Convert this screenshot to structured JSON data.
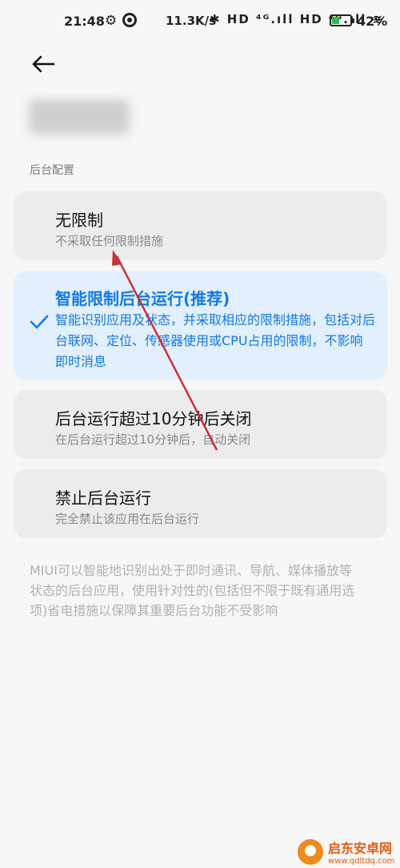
{
  "status_bar": {
    "time": "21:48",
    "speed": "11.3K/s",
    "icons": "✱ HD ⁴ᴳ.ıll HD ⁴ᴳ.ıll ≋",
    "battery_level": 0.42,
    "battery_pct": "42%",
    "battery_color": "#2fb84b"
  },
  "header": {
    "back_icon": "arrow-left-icon"
  },
  "section_label": "后台配置",
  "options": [
    {
      "title": "无限制",
      "subtitle": "不采取任何限制措施",
      "selected": false
    },
    {
      "title": "智能限制后台运行(推荐)",
      "subtitle": "智能识别应用及状态，并采取相应的限制措施，包括对后台联网、定位、传感器使用或CPU占用的限制，不影响即时消息",
      "selected": true
    },
    {
      "title": "后台运行超过10分钟后关闭",
      "subtitle": "在后台运行超过10分钟后，自动关闭",
      "selected": false
    },
    {
      "title": "禁止后台运行",
      "subtitle": "完全禁止该应用在后台运行",
      "selected": false
    }
  ],
  "footer_note": "MIUI可以智能地识别出处于即时通讯、导航、媒体播放等状态的后台应用，使用针对性的(包括但不限于既有通用选项)省电措施以保障其重要后台功能不受影响",
  "watermark": {
    "title": "启东安卓网",
    "url": "www.qdltdq.com"
  },
  "colors": {
    "accent": "#1479e6",
    "annotation": "#c8323a"
  }
}
